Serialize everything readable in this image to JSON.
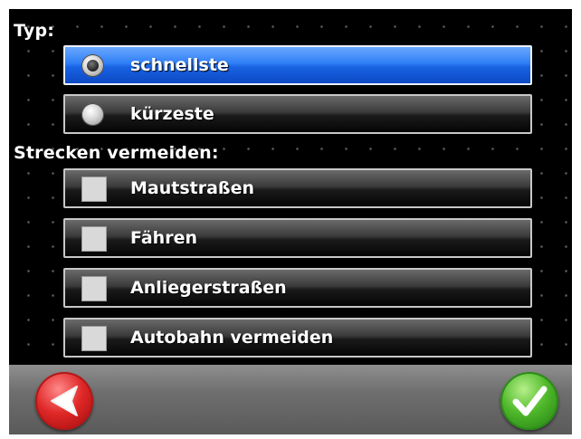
{
  "type_section": {
    "label": "Typ:",
    "options": [
      {
        "label": "schnellste",
        "selected": true
      },
      {
        "label": "kürzeste",
        "selected": false
      }
    ]
  },
  "avoid_section": {
    "label": "Strecken vermeiden:",
    "options": [
      {
        "label": "Mautstraßen",
        "checked": false
      },
      {
        "label": "Fähren",
        "checked": false
      },
      {
        "label": "Anliegerstraßen",
        "checked": false
      },
      {
        "label": "Autobahn vermeiden",
        "checked": false
      }
    ]
  },
  "footer": {
    "back_icon": "back-arrow-icon",
    "ok_icon": "checkmark-icon"
  },
  "colors": {
    "selected_blue": "#1863e3",
    "back_red": "#e02828",
    "ok_green": "#4fb82a"
  }
}
